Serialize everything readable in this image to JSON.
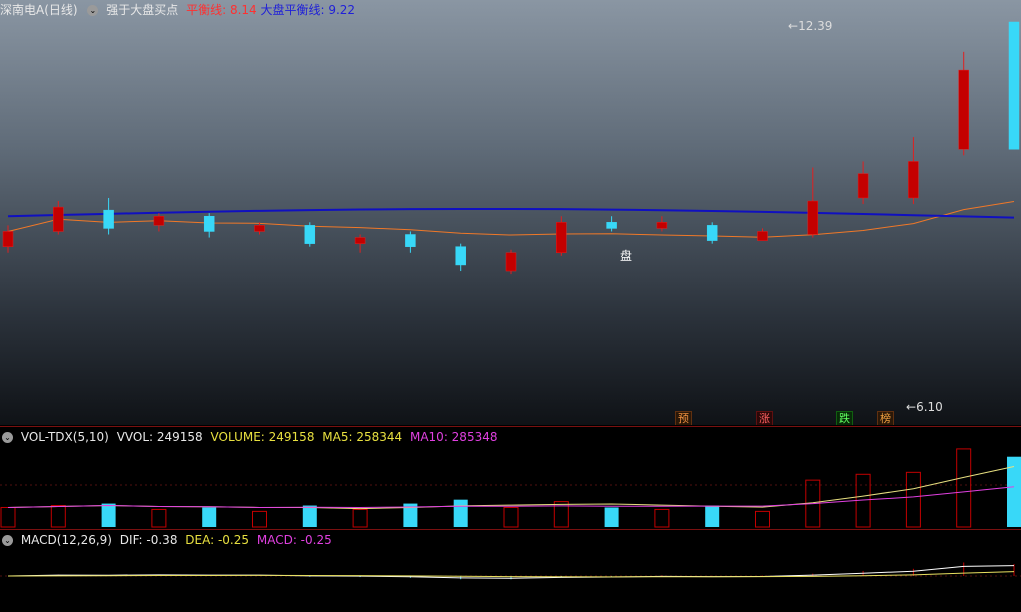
{
  "header": {
    "stock": "深南电A(日线)",
    "indicator": "强于大盘买点",
    "balance_label": "平衡线: ",
    "balance_value": "8.14",
    "market_balance_label": "大盘平衡线: ",
    "market_balance_value": "9.22"
  },
  "annotations": {
    "high": "12.39",
    "low": "6.10",
    "pan_marker": "盘",
    "badges": [
      "预",
      "涨",
      "跌",
      "榜"
    ]
  },
  "volume": {
    "title": "VOL-TDX(5,10)",
    "vvol": "VVOL: 249158",
    "volume": "VOLUME: 249158",
    "ma5": "MA5: 258344",
    "ma10": "MA10: 285348"
  },
  "macd": {
    "title": "MACD(12,26,9)",
    "dif": "DIF: -0.38",
    "dea": "DEA: -0.25",
    "macd": "MACD: -0.25"
  },
  "colors": {
    "up": "#c40000",
    "down": "#38d8f8",
    "ma_orange": "#f07828",
    "ma_blue": "#1010c0",
    "macd_white": "#ffffff",
    "macd_yellow": "#e8e060",
    "vol_ma5": "#e8e080",
    "vol_ma10": "#e040e0"
  },
  "chart_data": {
    "type": "candlestick",
    "price_range": [
      6.1,
      12.39
    ],
    "candles": [
      {
        "o": 8.7,
        "c": 8.95,
        "h": 9.05,
        "l": 8.6,
        "v": 50
      },
      {
        "o": 8.95,
        "c": 9.35,
        "h": 9.45,
        "l": 8.9,
        "v": 55
      },
      {
        "o": 9.3,
        "c": 9.0,
        "h": 9.5,
        "l": 8.9,
        "v": 60
      },
      {
        "o": 9.05,
        "c": 9.2,
        "h": 9.25,
        "l": 8.95,
        "v": 45
      },
      {
        "o": 9.2,
        "c": 8.95,
        "h": 9.25,
        "l": 8.85,
        "v": 50
      },
      {
        "o": 8.95,
        "c": 9.05,
        "h": 9.1,
        "l": 8.9,
        "v": 40
      },
      {
        "o": 9.05,
        "c": 8.75,
        "h": 9.1,
        "l": 8.7,
        "v": 55
      },
      {
        "o": 8.75,
        "c": 8.85,
        "h": 8.9,
        "l": 8.6,
        "v": 45
      },
      {
        "o": 8.9,
        "c": 8.7,
        "h": 8.95,
        "l": 8.6,
        "v": 60
      },
      {
        "o": 8.7,
        "c": 8.4,
        "h": 8.75,
        "l": 8.3,
        "v": 70
      },
      {
        "o": 8.3,
        "c": 8.6,
        "h": 8.65,
        "l": 8.25,
        "v": 50
      },
      {
        "o": 8.6,
        "c": 9.1,
        "h": 9.2,
        "l": 8.55,
        "v": 65
      },
      {
        "o": 9.1,
        "c": 9.0,
        "h": 9.2,
        "l": 8.95,
        "v": 50
      },
      {
        "o": 9.0,
        "c": 9.1,
        "h": 9.2,
        "l": 8.95,
        "v": 45
      },
      {
        "o": 9.05,
        "c": 8.8,
        "h": 9.1,
        "l": 8.75,
        "v": 55
      },
      {
        "o": 8.8,
        "c": 8.95,
        "h": 9.0,
        "l": 8.8,
        "v": 40
      },
      {
        "o": 8.9,
        "c": 9.45,
        "h": 10.0,
        "l": 8.85,
        "v": 120
      },
      {
        "o": 9.5,
        "c": 9.9,
        "h": 10.1,
        "l": 9.4,
        "v": 135
      },
      {
        "o": 9.5,
        "c": 10.1,
        "h": 10.5,
        "l": 9.4,
        "v": 140
      },
      {
        "o": 10.3,
        "c": 11.6,
        "h": 11.9,
        "l": 10.2,
        "v": 200
      },
      {
        "o": 12.39,
        "c": 10.3,
        "h": 12.39,
        "l": 10.3,
        "v": 180
      }
    ]
  }
}
